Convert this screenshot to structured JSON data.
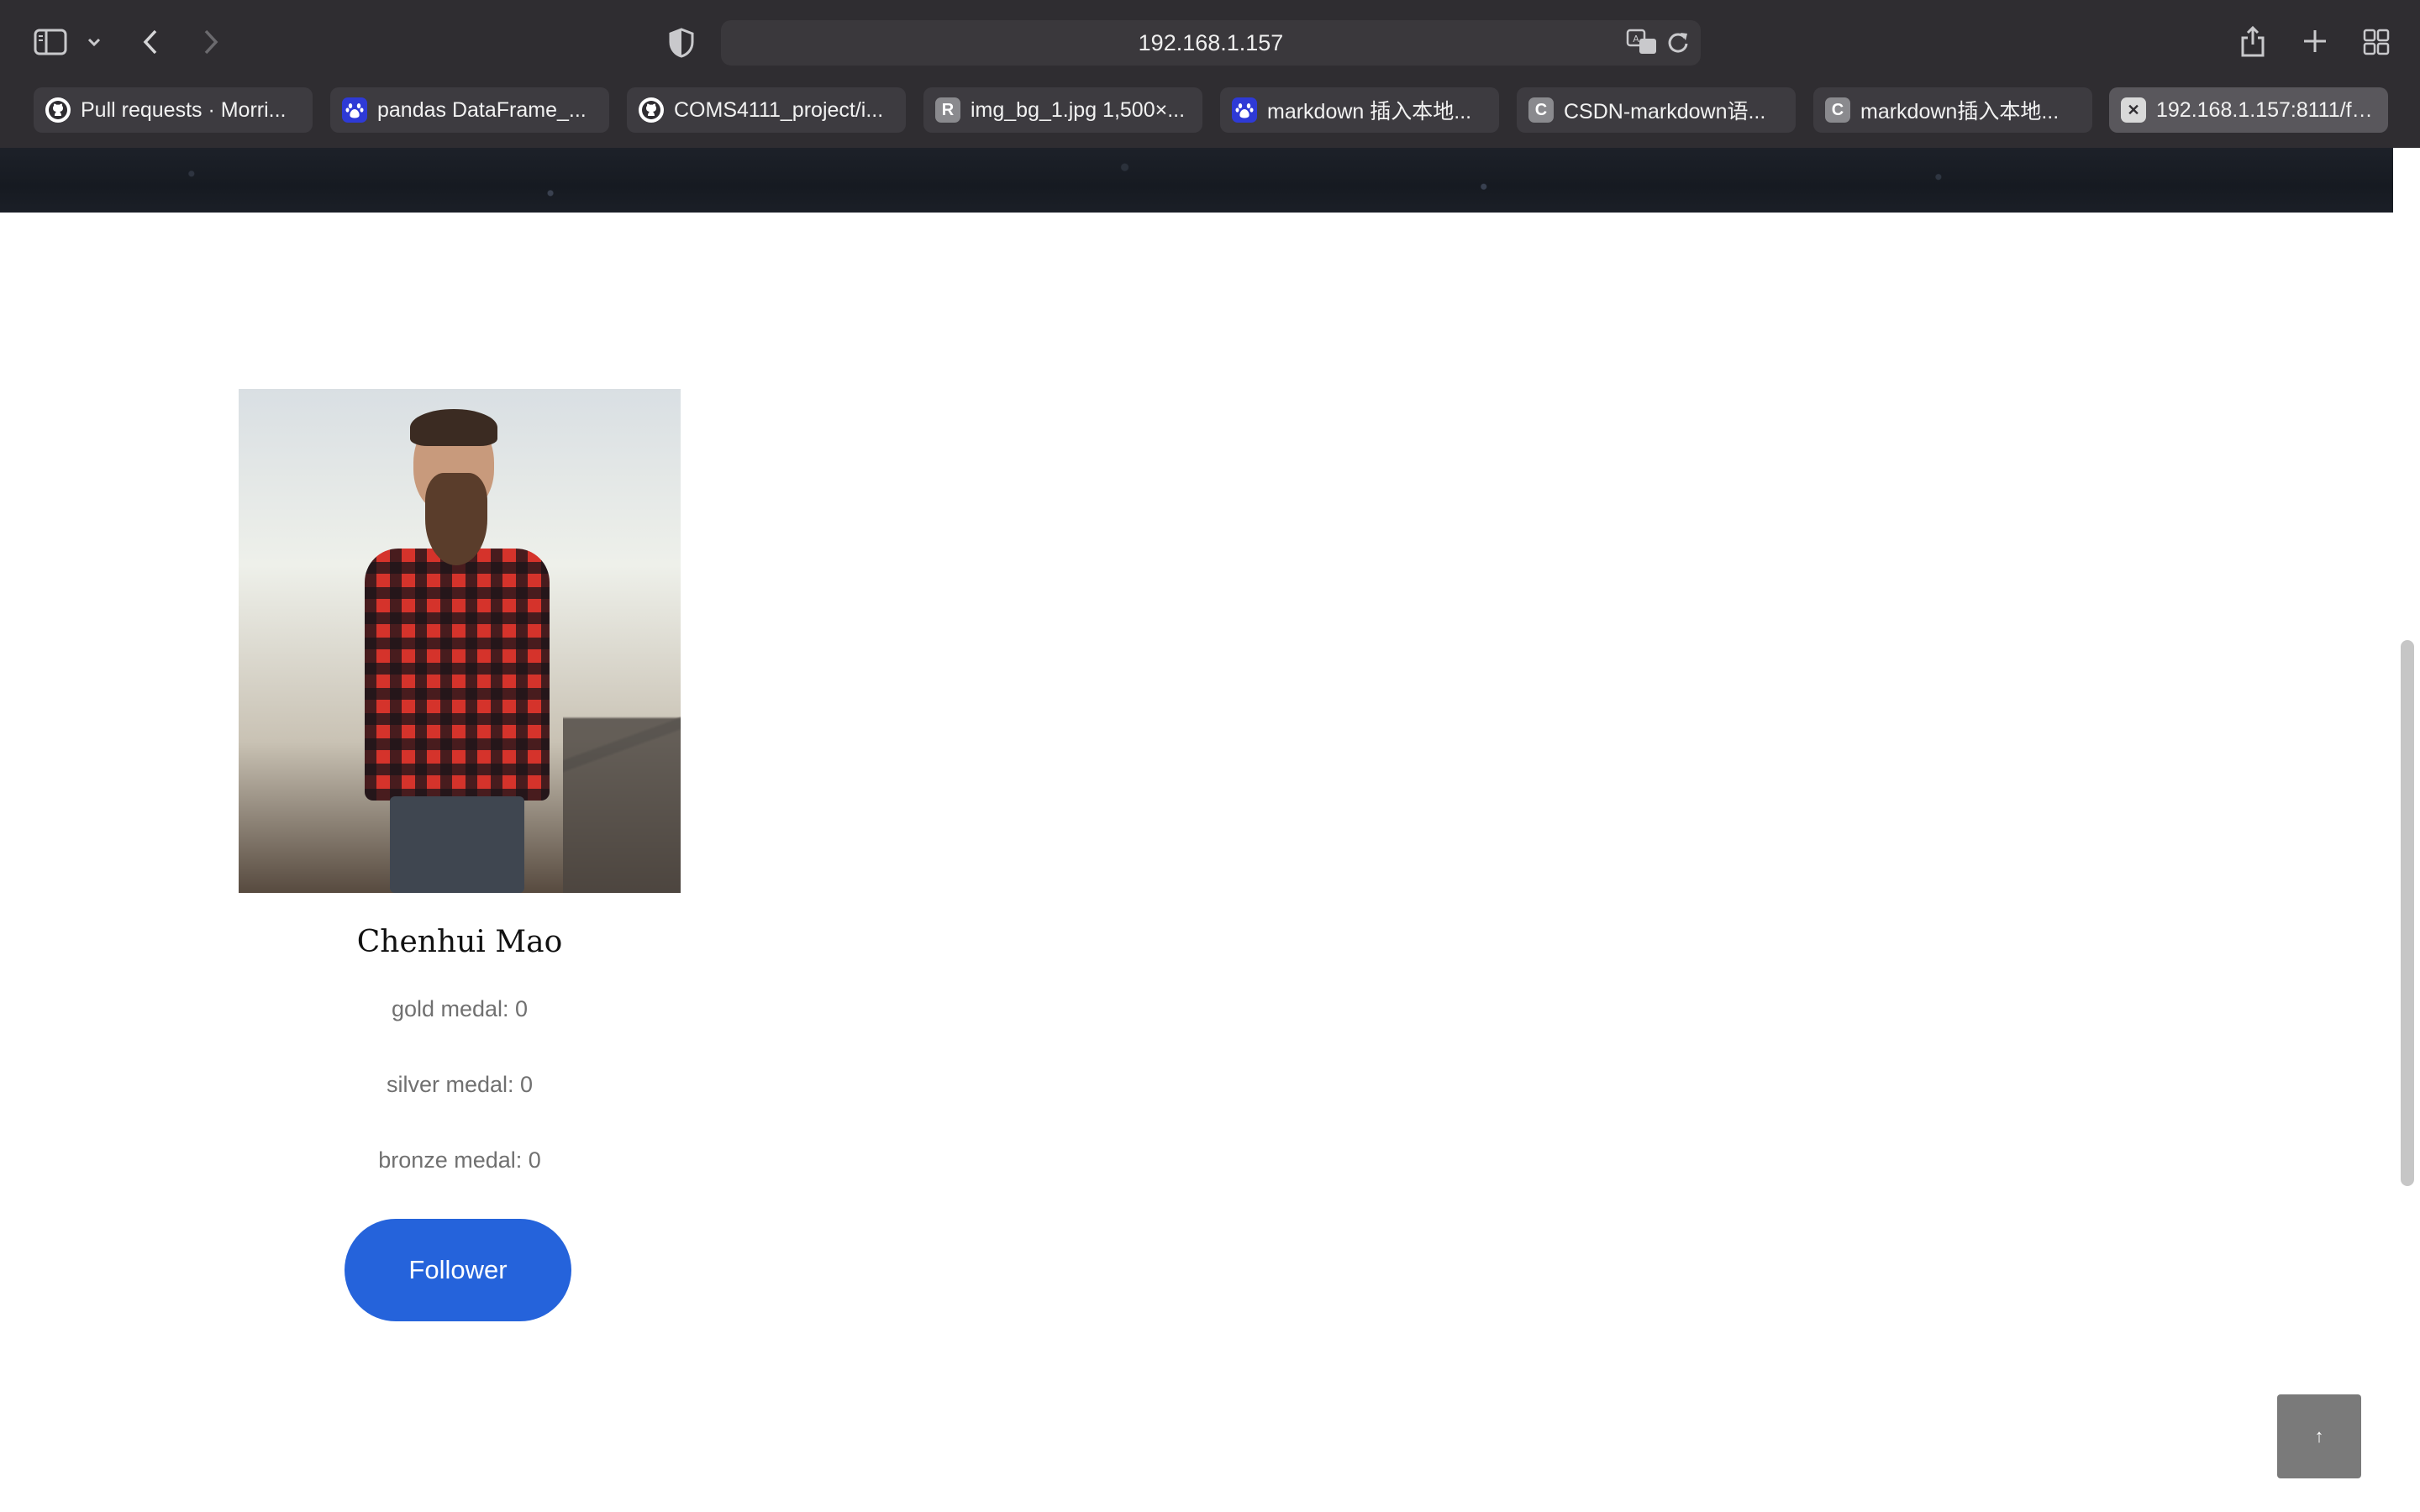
{
  "browser": {
    "address": "192.168.1.157",
    "tabs": [
      {
        "label": "Pull requests · Morri...",
        "favicon": "github-icon",
        "active": false
      },
      {
        "label": "pandas DataFrame_...",
        "favicon": "baidu-icon",
        "active": false
      },
      {
        "label": "COMS4111_project/i...",
        "favicon": "github-icon",
        "active": false
      },
      {
        "label": "img_bg_1.jpg 1,500×...",
        "favicon": "R",
        "active": false
      },
      {
        "label": "markdown 插入本地...",
        "favicon": "baidu-icon",
        "active": false
      },
      {
        "label": "CSDN-markdown语...",
        "favicon": "C",
        "active": false
      },
      {
        "label": "markdown插入本地...",
        "favicon": "C",
        "active": false
      },
      {
        "label": "192.168.1.157:8111/fo...",
        "favicon": "close-icon",
        "active": true
      }
    ]
  },
  "profile": {
    "name": "Chenhui Mao",
    "gold": "gold medal: 0",
    "silver": "silver medal: 0",
    "bronze": "bronze medal: 0",
    "follow_button": "Follower"
  },
  "back_to_top": {
    "label": "↑"
  },
  "colors": {
    "accent": "#2563db",
    "chrome": "#2f2d31"
  }
}
